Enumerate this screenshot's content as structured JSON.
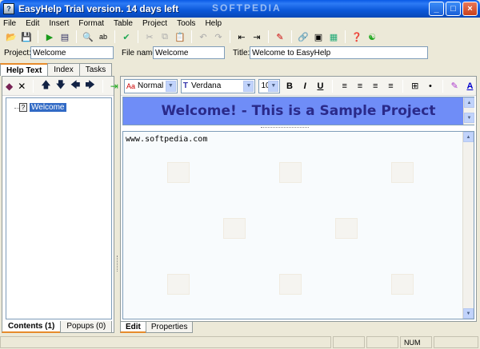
{
  "window": {
    "title": "EasyHelp Trial version. 14 days left",
    "watermark": "SOFTPEDIA",
    "controls": [
      "_",
      "□",
      "×"
    ]
  },
  "menu": [
    "File",
    "Edit",
    "Insert",
    "Format",
    "Table",
    "Project",
    "Tools",
    "Help"
  ],
  "project_row": {
    "project_label": "Project:",
    "project_value": "Welcome",
    "filename_label": "File name:",
    "filename_value": "Welcome",
    "title_label": "Title:",
    "title_value": "Welcome to EasyHelp"
  },
  "left_tabs": [
    "Help Text",
    "Index",
    "Tasks"
  ],
  "tree": {
    "items": [
      {
        "label": "Welcome",
        "selected": true
      }
    ]
  },
  "left_bottom_tabs": [
    "Contents (1)",
    "Popups (0)"
  ],
  "format_bar": {
    "style": "Normal",
    "font": "Verdana",
    "size": "10"
  },
  "document": {
    "heading": "Welcome! - This is a Sample Project",
    "body": "www.softpedia.com"
  },
  "editor_tabs": [
    "Edit",
    "Properties"
  ],
  "status": {
    "num": "NUM"
  },
  "colors": {
    "heading_band": "#6f8df7",
    "heading_text": "#2a2a8a",
    "accent_tab": "#e68b2c"
  }
}
